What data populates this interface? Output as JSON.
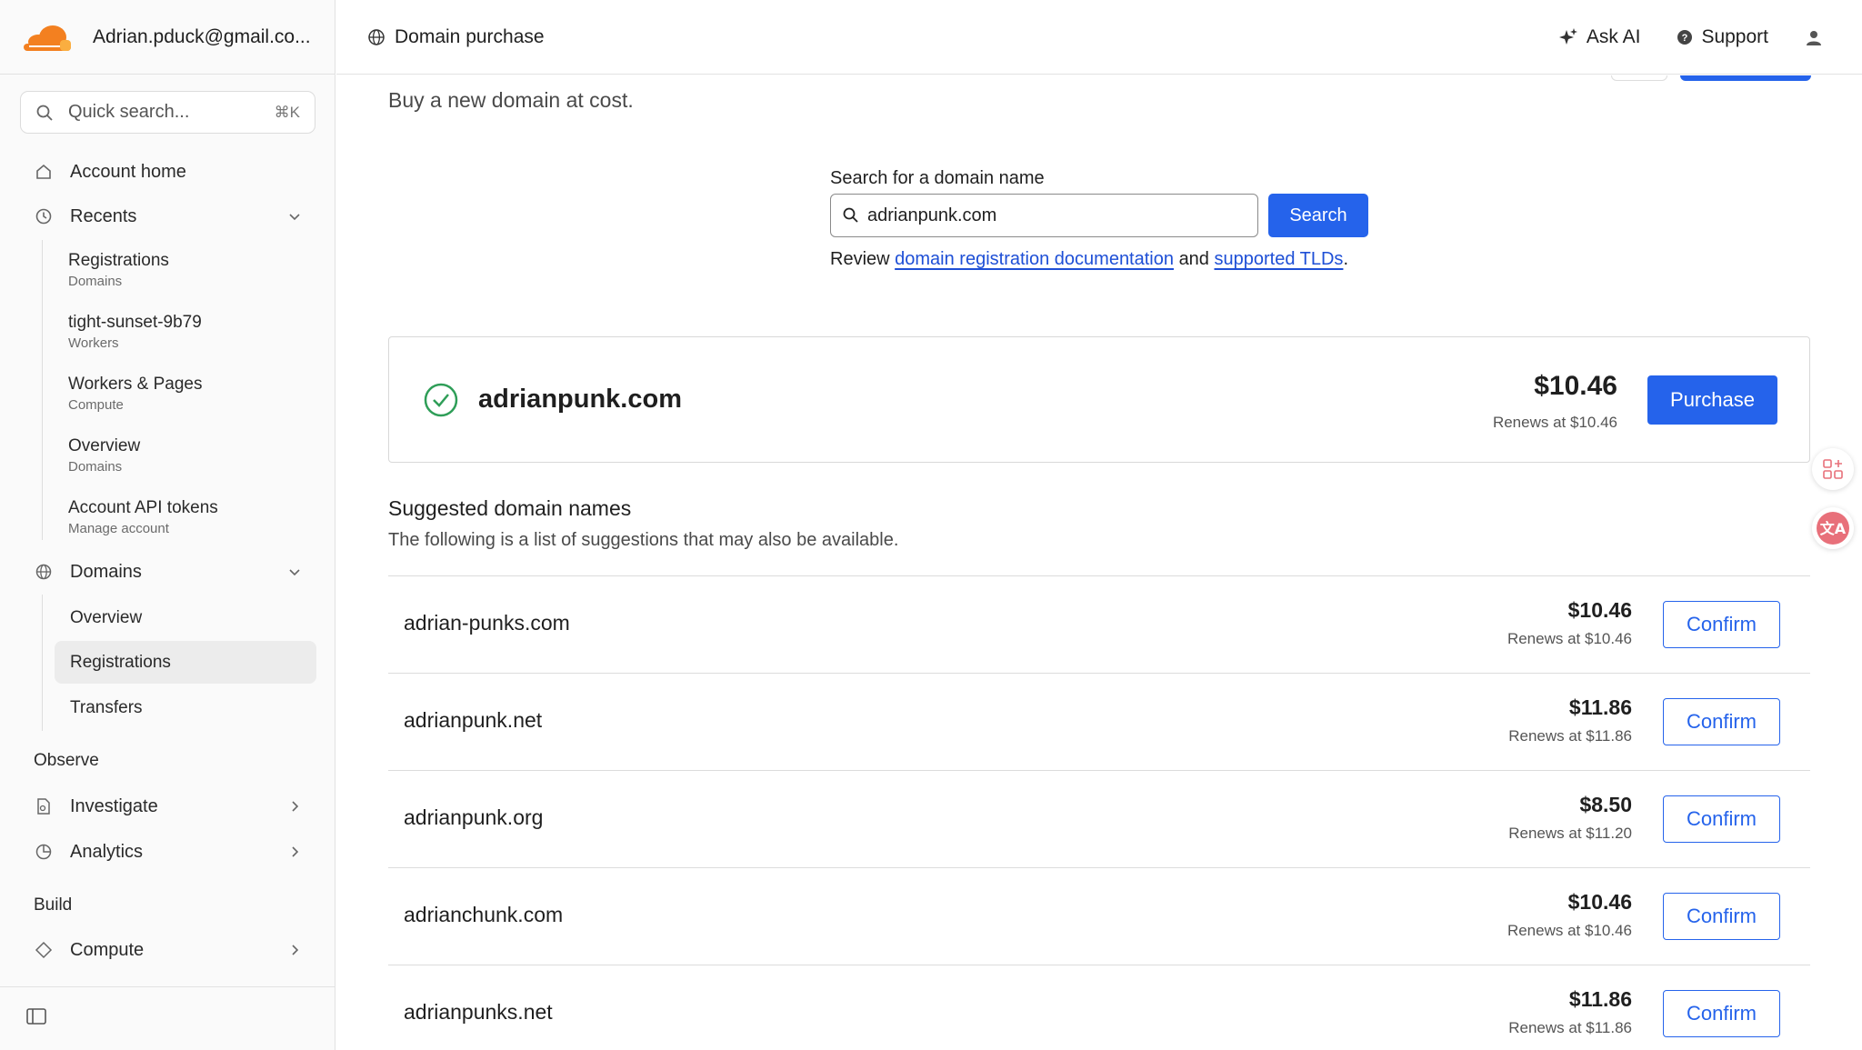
{
  "account": {
    "name": "Adrian.pduck@gmail.co..."
  },
  "quick_search": {
    "placeholder": "Quick search...",
    "shortcut": "⌘K"
  },
  "nav": {
    "account_home": "Account home",
    "recents": "Recents",
    "recent_items": [
      {
        "title": "Registrations",
        "sub": "Domains"
      },
      {
        "title": "tight-sunset-9b79",
        "sub": "Workers"
      },
      {
        "title": "Workers & Pages",
        "sub": "Compute"
      },
      {
        "title": "Overview",
        "sub": "Domains"
      },
      {
        "title": "Account API tokens",
        "sub": "Manage account"
      }
    ],
    "domains": "Domains",
    "domain_items": [
      "Overview",
      "Registrations",
      "Transfers"
    ],
    "observe": "Observe",
    "investigate": "Investigate",
    "analytics": "Analytics",
    "build": "Build",
    "compute": "Compute"
  },
  "topbar": {
    "breadcrumb": "Domain purchase",
    "ask_ai": "Ask AI",
    "support": "Support"
  },
  "page": {
    "subtitle": "Buy a new domain at cost."
  },
  "search": {
    "label": "Search for a domain name",
    "value": "adrianpunk.com",
    "button": "Search",
    "review_prefix": "Review",
    "review_link1": "domain registration documentation",
    "review_mid": "and",
    "review_link2": "supported TLDs",
    "review_suffix": "."
  },
  "result": {
    "domain": "adrianpunk.com",
    "price": "$10.46",
    "renew": "Renews at $10.46",
    "button": "Purchase"
  },
  "suggestions": {
    "title": "Suggested domain names",
    "subtitle": "The following is a list of suggestions that may also be available.",
    "confirm_label": "Confirm",
    "items": [
      {
        "domain": "adrian-punks.com",
        "price": "$10.46",
        "renew": "Renews at $10.46"
      },
      {
        "domain": "adrianpunk.net",
        "price": "$11.86",
        "renew": "Renews at $11.86"
      },
      {
        "domain": "adrianpunk.org",
        "price": "$8.50",
        "renew": "Renews at $11.20"
      },
      {
        "domain": "adrianchunk.com",
        "price": "$10.46",
        "renew": "Renews at $10.46"
      },
      {
        "domain": "adrianpunks.net",
        "price": "$11.86",
        "renew": "Renews at $11.86"
      }
    ]
  },
  "colors": {
    "accent": "#2563eb",
    "brand_orange": "#f38020",
    "success": "#2f9e58"
  }
}
